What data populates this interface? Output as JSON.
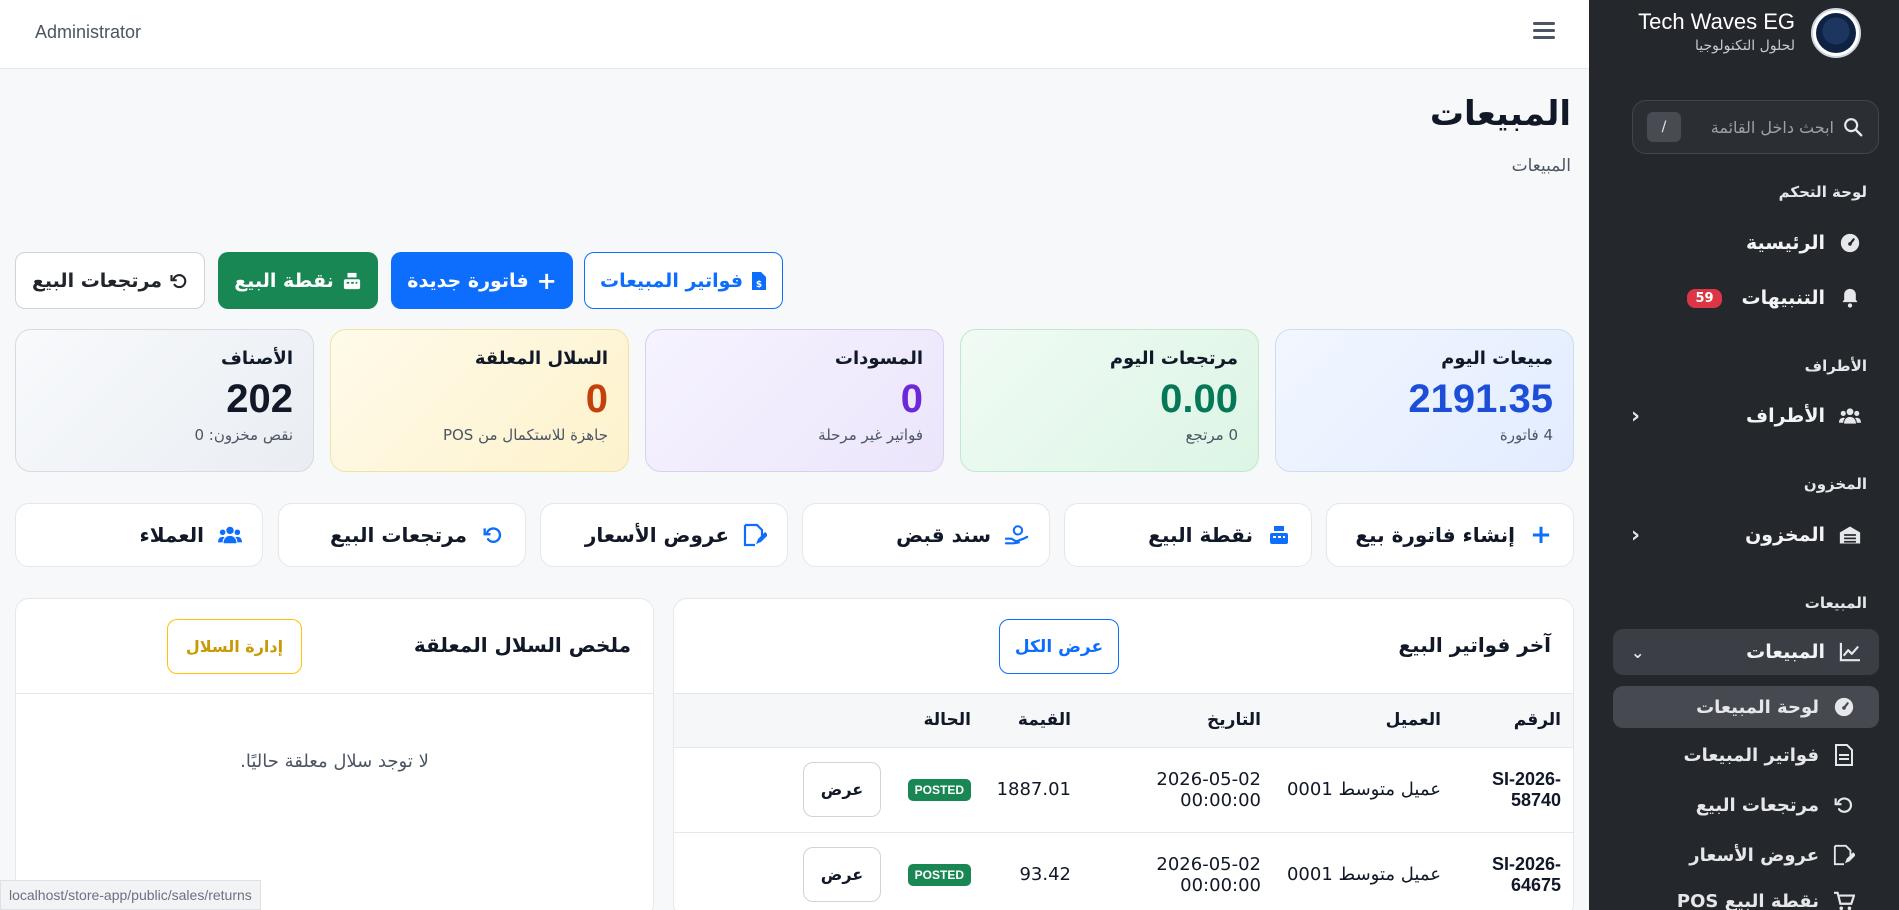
{
  "sidebar": {
    "brand": {
      "title": "Tech Waves EG",
      "subtitle": "لحلول التكنولوجيا",
      "logo_icon": "company-logo"
    },
    "search": {
      "placeholder": "ابحث داخل القائمة",
      "shortcut": "/"
    },
    "sections": {
      "dashboard": "لوحة التحكم",
      "parties": "الأطراف",
      "inventory": "المخزون",
      "sales": "المبيعات"
    },
    "items": {
      "home": "الرئيسية",
      "alerts": "التنبيهات",
      "alerts_count": "59",
      "parties": "الأطراف",
      "inventory": "المخزون",
      "sales": "المبيعات"
    },
    "sales_sub": {
      "dashboard": "لوحة المبيعات",
      "invoices": "فواتير المبيعات",
      "returns": "مرتجعات البيع",
      "quotes": "عروض الأسعار",
      "pos": "نقطة البيع POS"
    }
  },
  "topbar": {
    "user": "Administrator"
  },
  "header": {
    "title": "المبيعات",
    "breadcrumb": "المبيعات"
  },
  "actions": {
    "sales_invoices": "فواتير المبيعات",
    "new_invoice": "فاتورة جديدة",
    "pos": "نقطة البيع",
    "sales_returns": "مرتجعات البيع"
  },
  "stats": {
    "today_sales": {
      "label": "مبيعات اليوم",
      "value": "2191.35",
      "note": "4 فاتورة"
    },
    "today_returns": {
      "label": "مرتجعات اليوم",
      "value": "0.00",
      "note": "0 مرتجع"
    },
    "drafts": {
      "label": "المسودات",
      "value": "0",
      "note": "فواتير غير مرحلة"
    },
    "held_carts": {
      "label": "السلال المعلقة",
      "value": "0",
      "note": "جاهزة للاستكمال من POS"
    },
    "items": {
      "label": "الأصناف",
      "value": "202",
      "note": "نقص مخزون: 0"
    }
  },
  "quick_links": {
    "create_invoice": "إنشاء فاتورة بيع",
    "pos": "نقطة البيع",
    "receipt": "سند قبض",
    "quotes": "عروض الأسعار",
    "returns": "مرتجعات البيع",
    "customers": "العملاء"
  },
  "invoices_panel": {
    "title": "آخر فواتير البيع",
    "view_all": "عرض الكل",
    "columns": [
      "الرقم",
      "العميل",
      "التاريخ",
      "القيمة",
      "الحالة"
    ],
    "rows": [
      {
        "number": "SI-2026-58740",
        "customer": "عميل متوسط 0001",
        "date": "2026-05-02 00:00:00",
        "amount": "1887.01",
        "status": "POSTED",
        "action": "عرض"
      },
      {
        "number": "SI-2026-64675",
        "customer": "عميل متوسط 0001",
        "date": "2026-05-02 00:00:00",
        "amount": "93.42",
        "status": "POSTED",
        "action": "عرض"
      }
    ]
  },
  "carts_panel": {
    "title": "ملخص السلال المعلقة",
    "manage": "إدارة السلال",
    "empty": "لا توجد سلال معلقة حاليًا."
  },
  "status_bar": {
    "url": "localhost/store-app/public/sales/returns"
  },
  "colors": {
    "primary": "#0d6efd",
    "success": "#198754",
    "warning": "#ffc107",
    "danger": "#dc3545",
    "sidebar_bg": "#24272b"
  }
}
